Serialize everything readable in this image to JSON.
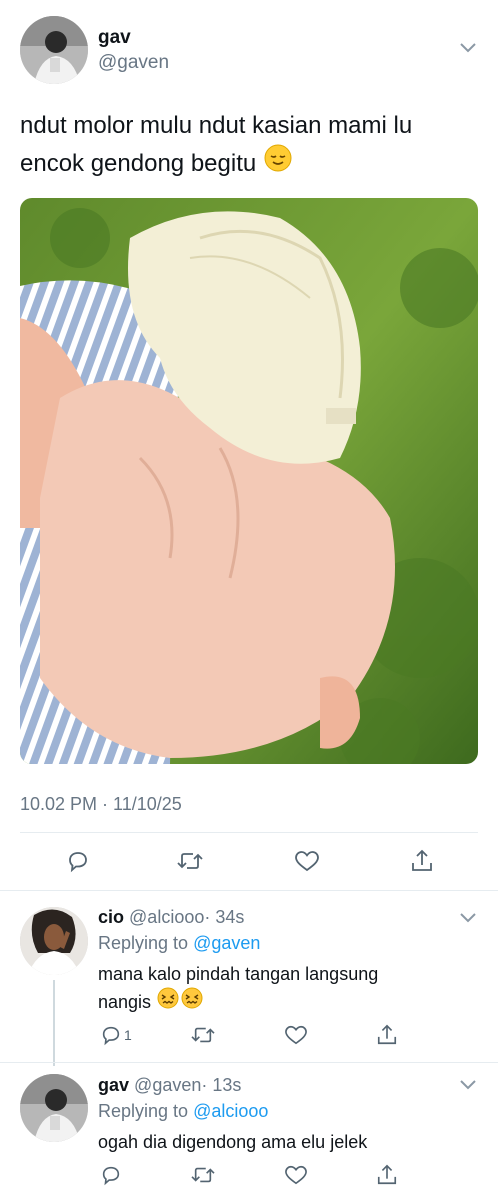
{
  "main_tweet": {
    "author_name": "gav",
    "handle": "@gaven",
    "text_line1": "ndut molor mulu ndut kasian mami lu",
    "text_line2": "encok gendong begitu",
    "timestamp": "10.02 PM · 11/10/25"
  },
  "actions": {
    "icons": [
      "reply-icon",
      "retweet-icon",
      "like-icon",
      "share-icon"
    ]
  },
  "replies": [
    {
      "author_name": "cio",
      "handle": "@alciooo",
      "time": "· 34s",
      "replying_prefix": "Replying to",
      "replying_to": "@gaven",
      "text_line1": "mana kalo pindah tangan langsung",
      "text_line2": "nangis",
      "reply_count": "1"
    },
    {
      "author_name": "gav",
      "handle": "@gaven",
      "time": "· 13s",
      "replying_prefix": "Replying to",
      "replying_to": "@alciooo",
      "text_line1": "ogah dia digendong ama elu jelek"
    }
  ],
  "colors": {
    "link": "#1d9bf0",
    "muted": "#687684",
    "divider": "#e6ecf0"
  }
}
